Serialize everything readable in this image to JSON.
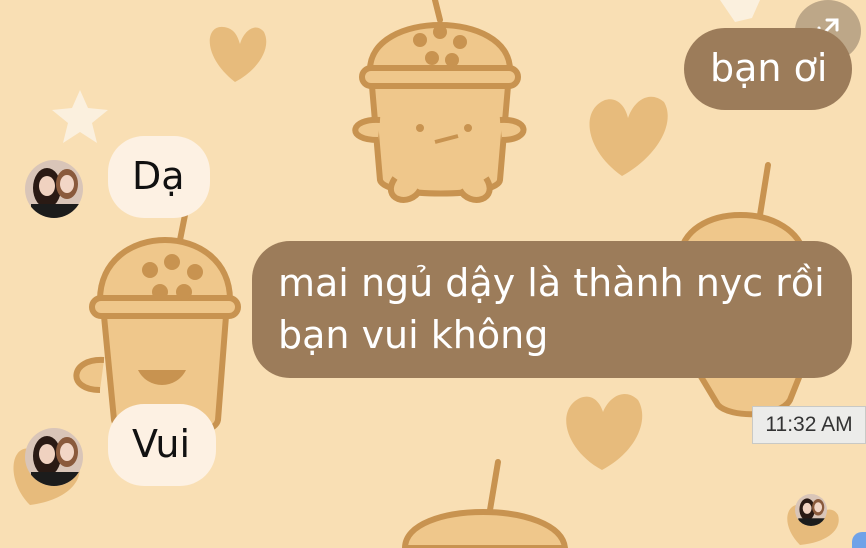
{
  "messages": [
    {
      "sender": "me",
      "text": "bạn ơi"
    },
    {
      "sender": "them",
      "text": "Dạ"
    },
    {
      "sender": "me",
      "lines": [
        "mai ngủ dậy là thành nyc rồi",
        "bạn vui không"
      ]
    },
    {
      "sender": "them",
      "text": "Vui"
    }
  ],
  "timestamp": "11:32 AM",
  "icons": {
    "expand": "expand-arrows-icon",
    "avatar": "profile-photo-two-girls"
  },
  "colors": {
    "background": "#f9dfb4",
    "outgoing_bubble": "#9c7c5a",
    "incoming_bubble": "#fdf1e3",
    "wallpaper_art": "#dcaa6c"
  }
}
